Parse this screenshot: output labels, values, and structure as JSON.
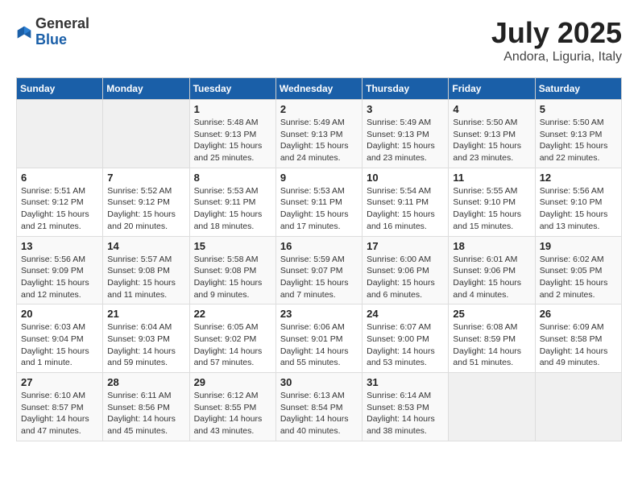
{
  "header": {
    "logo_general": "General",
    "logo_blue": "Blue",
    "month_year": "July 2025",
    "location": "Andora, Liguria, Italy"
  },
  "days_of_week": [
    "Sunday",
    "Monday",
    "Tuesday",
    "Wednesday",
    "Thursday",
    "Friday",
    "Saturday"
  ],
  "weeks": [
    [
      {
        "day": "",
        "info": ""
      },
      {
        "day": "",
        "info": ""
      },
      {
        "day": "1",
        "info": "Sunrise: 5:48 AM\nSunset: 9:13 PM\nDaylight: 15 hours\nand 25 minutes."
      },
      {
        "day": "2",
        "info": "Sunrise: 5:49 AM\nSunset: 9:13 PM\nDaylight: 15 hours\nand 24 minutes."
      },
      {
        "day": "3",
        "info": "Sunrise: 5:49 AM\nSunset: 9:13 PM\nDaylight: 15 hours\nand 23 minutes."
      },
      {
        "day": "4",
        "info": "Sunrise: 5:50 AM\nSunset: 9:13 PM\nDaylight: 15 hours\nand 23 minutes."
      },
      {
        "day": "5",
        "info": "Sunrise: 5:50 AM\nSunset: 9:13 PM\nDaylight: 15 hours\nand 22 minutes."
      }
    ],
    [
      {
        "day": "6",
        "info": "Sunrise: 5:51 AM\nSunset: 9:12 PM\nDaylight: 15 hours\nand 21 minutes."
      },
      {
        "day": "7",
        "info": "Sunrise: 5:52 AM\nSunset: 9:12 PM\nDaylight: 15 hours\nand 20 minutes."
      },
      {
        "day": "8",
        "info": "Sunrise: 5:53 AM\nSunset: 9:11 PM\nDaylight: 15 hours\nand 18 minutes."
      },
      {
        "day": "9",
        "info": "Sunrise: 5:53 AM\nSunset: 9:11 PM\nDaylight: 15 hours\nand 17 minutes."
      },
      {
        "day": "10",
        "info": "Sunrise: 5:54 AM\nSunset: 9:11 PM\nDaylight: 15 hours\nand 16 minutes."
      },
      {
        "day": "11",
        "info": "Sunrise: 5:55 AM\nSunset: 9:10 PM\nDaylight: 15 hours\nand 15 minutes."
      },
      {
        "day": "12",
        "info": "Sunrise: 5:56 AM\nSunset: 9:10 PM\nDaylight: 15 hours\nand 13 minutes."
      }
    ],
    [
      {
        "day": "13",
        "info": "Sunrise: 5:56 AM\nSunset: 9:09 PM\nDaylight: 15 hours\nand 12 minutes."
      },
      {
        "day": "14",
        "info": "Sunrise: 5:57 AM\nSunset: 9:08 PM\nDaylight: 15 hours\nand 11 minutes."
      },
      {
        "day": "15",
        "info": "Sunrise: 5:58 AM\nSunset: 9:08 PM\nDaylight: 15 hours\nand 9 minutes."
      },
      {
        "day": "16",
        "info": "Sunrise: 5:59 AM\nSunset: 9:07 PM\nDaylight: 15 hours\nand 7 minutes."
      },
      {
        "day": "17",
        "info": "Sunrise: 6:00 AM\nSunset: 9:06 PM\nDaylight: 15 hours\nand 6 minutes."
      },
      {
        "day": "18",
        "info": "Sunrise: 6:01 AM\nSunset: 9:06 PM\nDaylight: 15 hours\nand 4 minutes."
      },
      {
        "day": "19",
        "info": "Sunrise: 6:02 AM\nSunset: 9:05 PM\nDaylight: 15 hours\nand 2 minutes."
      }
    ],
    [
      {
        "day": "20",
        "info": "Sunrise: 6:03 AM\nSunset: 9:04 PM\nDaylight: 15 hours\nand 1 minute."
      },
      {
        "day": "21",
        "info": "Sunrise: 6:04 AM\nSunset: 9:03 PM\nDaylight: 14 hours\nand 59 minutes."
      },
      {
        "day": "22",
        "info": "Sunrise: 6:05 AM\nSunset: 9:02 PM\nDaylight: 14 hours\nand 57 minutes."
      },
      {
        "day": "23",
        "info": "Sunrise: 6:06 AM\nSunset: 9:01 PM\nDaylight: 14 hours\nand 55 minutes."
      },
      {
        "day": "24",
        "info": "Sunrise: 6:07 AM\nSunset: 9:00 PM\nDaylight: 14 hours\nand 53 minutes."
      },
      {
        "day": "25",
        "info": "Sunrise: 6:08 AM\nSunset: 8:59 PM\nDaylight: 14 hours\nand 51 minutes."
      },
      {
        "day": "26",
        "info": "Sunrise: 6:09 AM\nSunset: 8:58 PM\nDaylight: 14 hours\nand 49 minutes."
      }
    ],
    [
      {
        "day": "27",
        "info": "Sunrise: 6:10 AM\nSunset: 8:57 PM\nDaylight: 14 hours\nand 47 minutes."
      },
      {
        "day": "28",
        "info": "Sunrise: 6:11 AM\nSunset: 8:56 PM\nDaylight: 14 hours\nand 45 minutes."
      },
      {
        "day": "29",
        "info": "Sunrise: 6:12 AM\nSunset: 8:55 PM\nDaylight: 14 hours\nand 43 minutes."
      },
      {
        "day": "30",
        "info": "Sunrise: 6:13 AM\nSunset: 8:54 PM\nDaylight: 14 hours\nand 40 minutes."
      },
      {
        "day": "31",
        "info": "Sunrise: 6:14 AM\nSunset: 8:53 PM\nDaylight: 14 hours\nand 38 minutes."
      },
      {
        "day": "",
        "info": ""
      },
      {
        "day": "",
        "info": ""
      }
    ]
  ]
}
